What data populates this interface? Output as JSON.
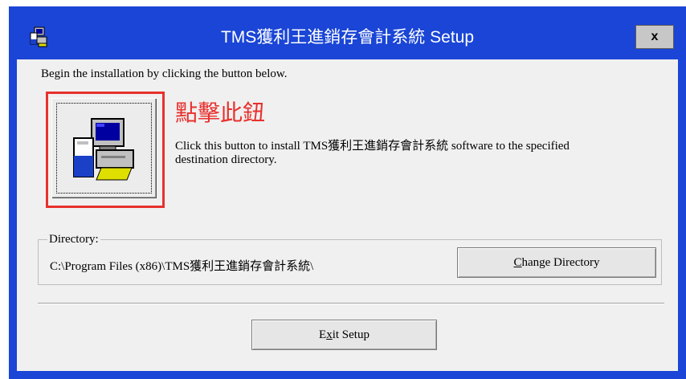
{
  "window": {
    "title": "TMS獲利王進銷存會計系統 Setup",
    "close_label": "x",
    "accent_color": "#1a45d6",
    "app_icon": "setup-computer-icon"
  },
  "intro_text": "Begin the installation by clicking the button below.",
  "install": {
    "headline": "點擊此鈕",
    "description": "Click this button to install TMS獲利王進銷存會計系統 software to the specified destination directory.",
    "icon": "computer-install-icon",
    "highlight_color": "#e8302d"
  },
  "directory": {
    "label": "Directory:",
    "path": "C:\\Program Files (x86)\\TMS獲利王進銷存會計系統\\",
    "change_button_prefix": "",
    "change_button_mnemonic": "C",
    "change_button_rest": "hange Directory"
  },
  "exit_button": {
    "prefix": "E",
    "mnemonic": "x",
    "rest": "it Setup"
  }
}
